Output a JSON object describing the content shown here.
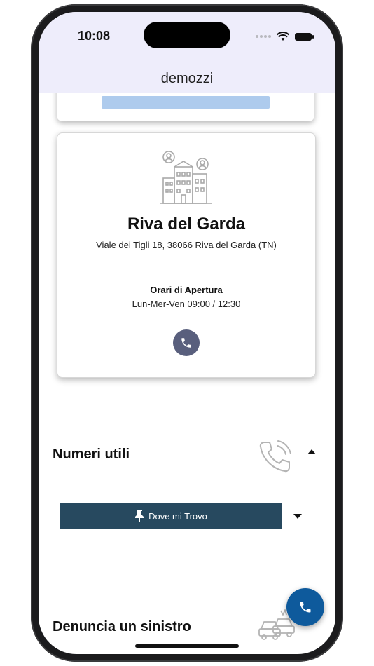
{
  "status_bar": {
    "time": "10:08"
  },
  "app_bar": {
    "title": "demozzi"
  },
  "office": {
    "name": "Riva del Garda",
    "address": "Viale dei Tigli 18, 38066 Riva del Garda (TN)",
    "hours_label": "Orari di Apertura",
    "hours_value": "Lun-Mer-Ven 09:00 / 12:30"
  },
  "sections": {
    "numeri_utili": "Numeri utili",
    "denuncia_sinistro": "Denuncia un sinistro"
  },
  "where_button": {
    "label": "Dove mi Trovo"
  },
  "icons": {
    "building": "building-people-icon",
    "phone": "phone-icon",
    "pin": "pushpin-icon",
    "cars": "cars-accident-icon"
  },
  "colors": {
    "app_bar_bg": "#eeedfb",
    "phone_button": "#595f7d",
    "where_button": "#27495f",
    "fab": "#0e5a9c"
  }
}
